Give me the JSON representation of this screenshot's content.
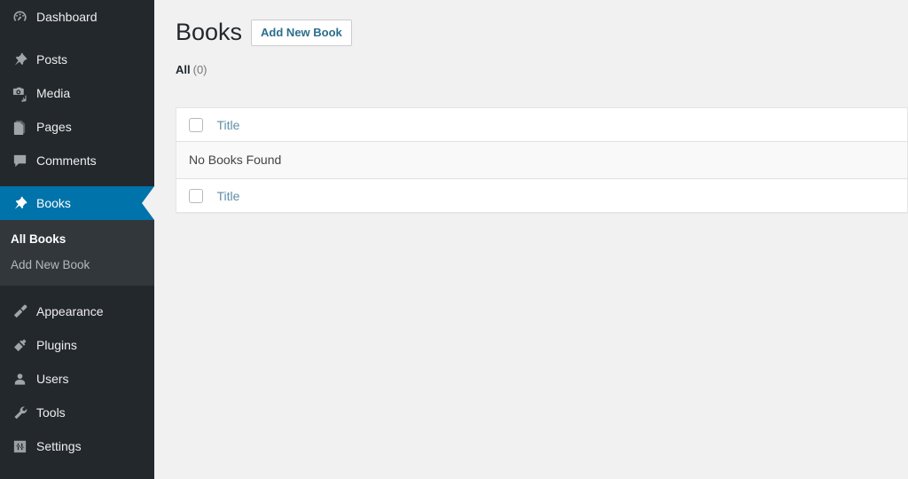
{
  "sidebar": {
    "items": [
      {
        "label": "Dashboard",
        "icon": "dashboard-icon",
        "name": "dashboard",
        "current": false
      },
      {
        "label": "Posts",
        "icon": "pin-icon",
        "name": "posts",
        "current": false
      },
      {
        "label": "Media",
        "icon": "media-icon",
        "name": "media",
        "current": false
      },
      {
        "label": "Pages",
        "icon": "pages-icon",
        "name": "pages",
        "current": false
      },
      {
        "label": "Comments",
        "icon": "comments-icon",
        "name": "comments",
        "current": false
      },
      {
        "label": "Books",
        "icon": "pin-icon",
        "name": "books",
        "current": true
      }
    ],
    "submenu": [
      {
        "label": "All Books",
        "name": "all-books",
        "current": true
      },
      {
        "label": "Add New Book",
        "name": "add-new-book",
        "current": false
      }
    ],
    "items_after": [
      {
        "label": "Appearance",
        "icon": "appearance-icon",
        "name": "appearance",
        "current": false
      },
      {
        "label": "Plugins",
        "icon": "plugins-icon",
        "name": "plugins",
        "current": false
      },
      {
        "label": "Users",
        "icon": "users-icon",
        "name": "users",
        "current": false
      },
      {
        "label": "Tools",
        "icon": "tools-icon",
        "name": "tools",
        "current": false
      },
      {
        "label": "Settings",
        "icon": "settings-icon",
        "name": "settings",
        "current": false
      }
    ],
    "colors": {
      "background": "#23282d",
      "submenu_background": "#32373c",
      "current_background": "#0073aa"
    }
  },
  "main": {
    "title": "Books",
    "add_new_label": "Add New Book",
    "filters": [
      {
        "label": "All",
        "count": "(0)"
      }
    ],
    "table": {
      "header": {
        "title_column": "Title"
      },
      "footer": {
        "title_column": "Title"
      },
      "empty_message": "No Books Found",
      "rows": []
    }
  },
  "colors": {
    "page_background": "#f1f1f1",
    "link": "#0073aa",
    "button_text": "#2a6e8e"
  }
}
